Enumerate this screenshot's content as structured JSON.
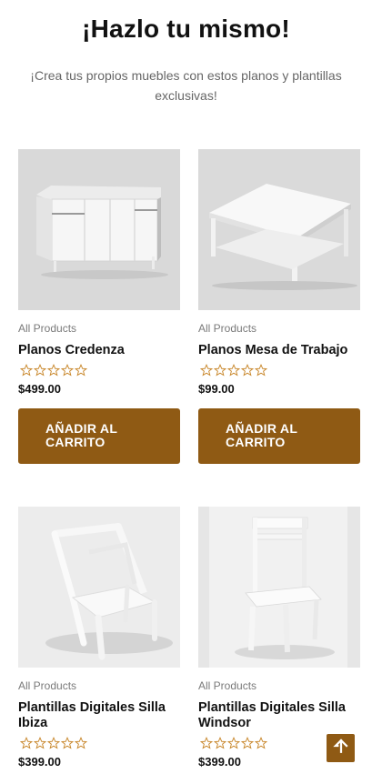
{
  "header": {
    "title": "¡Hazlo tu mismo!",
    "subtitle": "¡Crea tus propios muebles con estos planos y plantillas exclusivas!"
  },
  "products": [
    {
      "category": "All Products",
      "name": "Planos Credenza",
      "price": "$499.00",
      "rating": 0,
      "button": "AÑADIR AL CARRITO",
      "image": "white-credenza"
    },
    {
      "category": "All Products",
      "name": "Planos Mesa de Trabajo",
      "price": "$99.00",
      "rating": 0,
      "button": "AÑADIR AL CARRITO",
      "image": "white-work-table"
    },
    {
      "category": "All Products",
      "name": "Plantillas Digitales Silla Ibiza",
      "price": "$399.00",
      "rating": 0,
      "image": "white-ibiza-chair"
    },
    {
      "category": "All Products",
      "name": "Plantillas Digitales Silla Windsor",
      "price": "$399.00",
      "rating": 0,
      "image": "white-windsor-chair"
    }
  ],
  "colors": {
    "accent": "#8f5a14",
    "star": "#c8872b",
    "muted": "#7a7a7a"
  },
  "scroll_top": {
    "icon": "arrow-up-icon"
  }
}
